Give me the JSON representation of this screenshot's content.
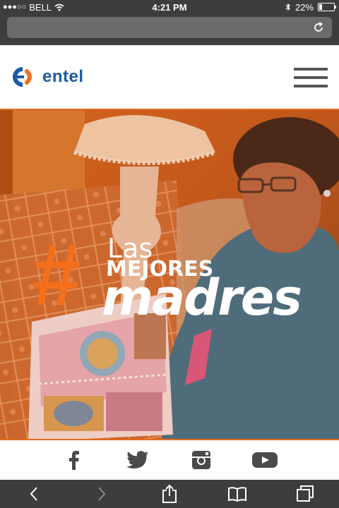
{
  "status_bar": {
    "carrier": "BELL",
    "time": "4:21 PM",
    "battery": "22%",
    "battery_level": 0.22
  },
  "header": {
    "brand": "entel"
  },
  "hero": {
    "hash": "#",
    "line1": "Las",
    "line2": "MEJORES",
    "line3": "madres"
  },
  "social": {
    "icons": [
      "facebook-icon",
      "twitter-icon",
      "instagram-icon",
      "youtube-icon"
    ]
  },
  "colors": {
    "accent": "#f36f1b",
    "brand_blue": "#1c5aa6",
    "chrome": "#3d3d3d"
  }
}
